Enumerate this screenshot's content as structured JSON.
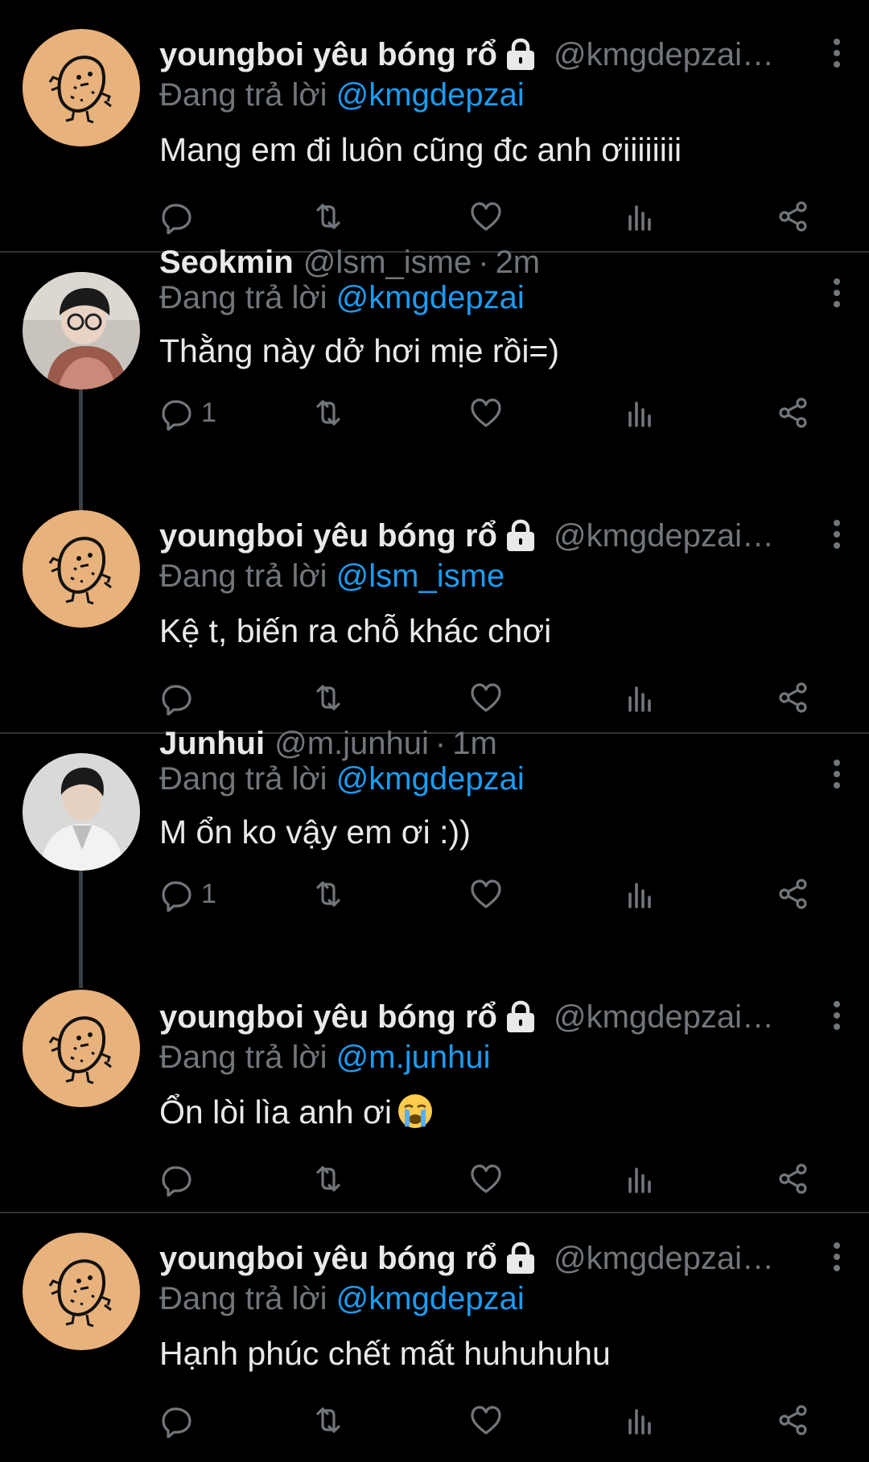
{
  "colors": {
    "background": "#000000",
    "text": "#e7e9ea",
    "muted": "#71767b",
    "link": "#1d9bf0",
    "divider": "#2f3336",
    "avatar_bg": "#e8b27c"
  },
  "reply_prefix": "Đang trả lời",
  "tweets": [
    {
      "name": "youngboi yêu bóng rổ",
      "handle": "@kmgdepzai ·...",
      "time": "",
      "locked": true,
      "reply_to": "@kmgdepzai",
      "text": "Mang em đi luôn cũng đc anh ơiiiiiiii",
      "reply_count": "",
      "avatar_icon": "potato-avatar"
    },
    {
      "name": "Seokmin",
      "handle": "@lsm_isme",
      "time": "2m",
      "locked": false,
      "reply_to": "@kmgdepzai",
      "text": "Thằng này dở hơi mịe rồi=)",
      "reply_count": "1",
      "avatar_icon": "photo-avatar"
    },
    {
      "name": "youngboi yêu bóng rổ",
      "handle": "@kmgdepzai ·...",
      "time": "",
      "locked": true,
      "reply_to": "@lsm_isme",
      "text": "Kệ t, biến ra chỗ khác chơi",
      "reply_count": "",
      "avatar_icon": "potato-avatar"
    },
    {
      "name": "Junhui",
      "handle": "@m.junhui",
      "time": "1m",
      "locked": false,
      "reply_to": "@kmgdepzai",
      "text": "M ổn ko vậy em ơi :))",
      "reply_count": "1",
      "avatar_icon": "photo-avatar"
    },
    {
      "name": "youngboi yêu bóng rổ",
      "handle": "@kmgdepzai ·...",
      "time": "",
      "locked": true,
      "reply_to": "@m.junhui",
      "text": "Ổn lòi lìa anh ơi",
      "reply_count": "",
      "avatar_icon": "potato-avatar",
      "emoji": "crying-face-emoji"
    },
    {
      "name": "youngboi yêu bóng rổ",
      "handle": "@kmgdepzai ·...",
      "time": "",
      "locked": true,
      "reply_to": "@kmgdepzai",
      "text": "Hạnh phúc chết mất huhuhuhu",
      "reply_count": "",
      "avatar_icon": "potato-avatar"
    }
  ]
}
